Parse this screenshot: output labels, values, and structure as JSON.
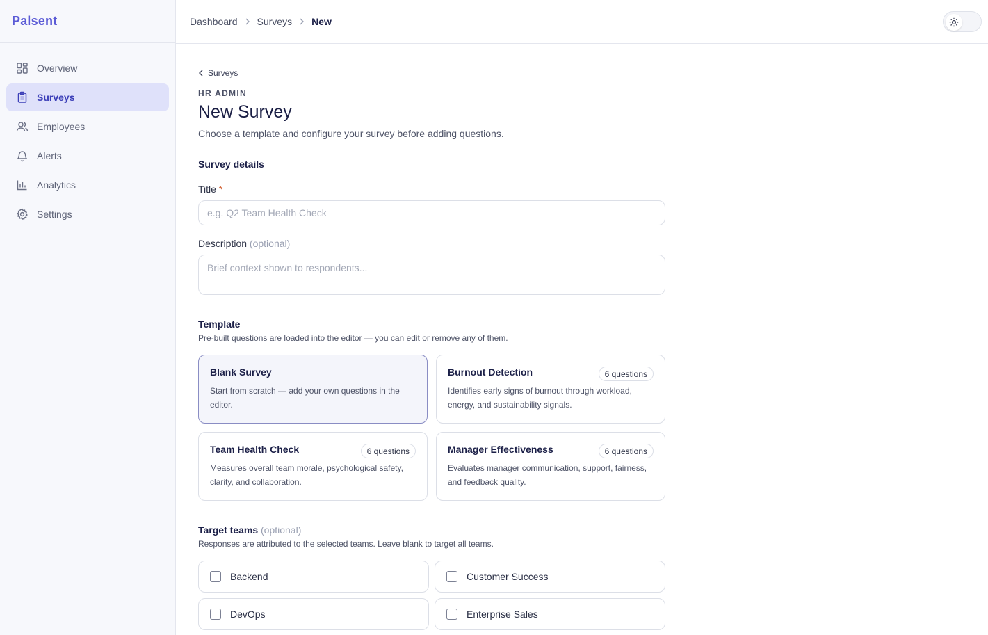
{
  "app": {
    "brand": "Palsent"
  },
  "sidebar": {
    "items": [
      {
        "label": "Overview",
        "icon": "layout-grid-icon",
        "active": false
      },
      {
        "label": "Surveys",
        "icon": "clipboard-icon",
        "active": true
      },
      {
        "label": "Employees",
        "icon": "users-icon",
        "active": false
      },
      {
        "label": "Alerts",
        "icon": "bell-icon",
        "active": false
      },
      {
        "label": "Analytics",
        "icon": "bar-chart-icon",
        "active": false
      },
      {
        "label": "Settings",
        "icon": "gear-icon",
        "active": false
      }
    ]
  },
  "header": {
    "breadcrumb": [
      "Dashboard",
      "Surveys",
      "New"
    ],
    "theme_toggle_icon": "sun-icon"
  },
  "page": {
    "back_label": "Surveys",
    "eyebrow": "HR ADMIN",
    "title": "New Survey",
    "subtitle": "Choose a template and configure your survey before adding questions."
  },
  "details": {
    "heading": "Survey details",
    "title_label": "Title",
    "title_required": "*",
    "title_placeholder": "e.g. Q2 Team Health Check",
    "description_label": "Description",
    "description_optional": "(optional)",
    "description_placeholder": "Brief context shown to respondents..."
  },
  "template": {
    "heading": "Template",
    "note": "Pre-built questions are loaded into the editor — you can edit or remove any of them.",
    "cards": [
      {
        "title": "Blank Survey",
        "desc": "Start from scratch — add your own questions in the editor.",
        "badge": "",
        "selected": true
      },
      {
        "title": "Burnout Detection",
        "desc": "Identifies early signs of burnout through workload, energy, and sustainability signals.",
        "badge": "6 questions",
        "selected": false
      },
      {
        "title": "Team Health Check",
        "desc": "Measures overall team morale, psychological safety, clarity, and collaboration.",
        "badge": "6 questions",
        "selected": false
      },
      {
        "title": "Manager Effectiveness",
        "desc": "Evaluates manager communication, support, fairness, and feedback quality.",
        "badge": "6 questions",
        "selected": false
      }
    ]
  },
  "teams": {
    "heading": "Target teams",
    "optional": "(optional)",
    "note": "Responses are attributed to the selected teams. Leave blank to target all teams.",
    "items": [
      {
        "label": "Backend",
        "checked": false
      },
      {
        "label": "Customer Success",
        "checked": false
      },
      {
        "label": "DevOps",
        "checked": false
      },
      {
        "label": "Enterprise Sales",
        "checked": false
      }
    ]
  },
  "colors": {
    "brand": "#5b5bd6",
    "active_bg": "#dfe1fa",
    "active_text": "#3c3fb8"
  }
}
